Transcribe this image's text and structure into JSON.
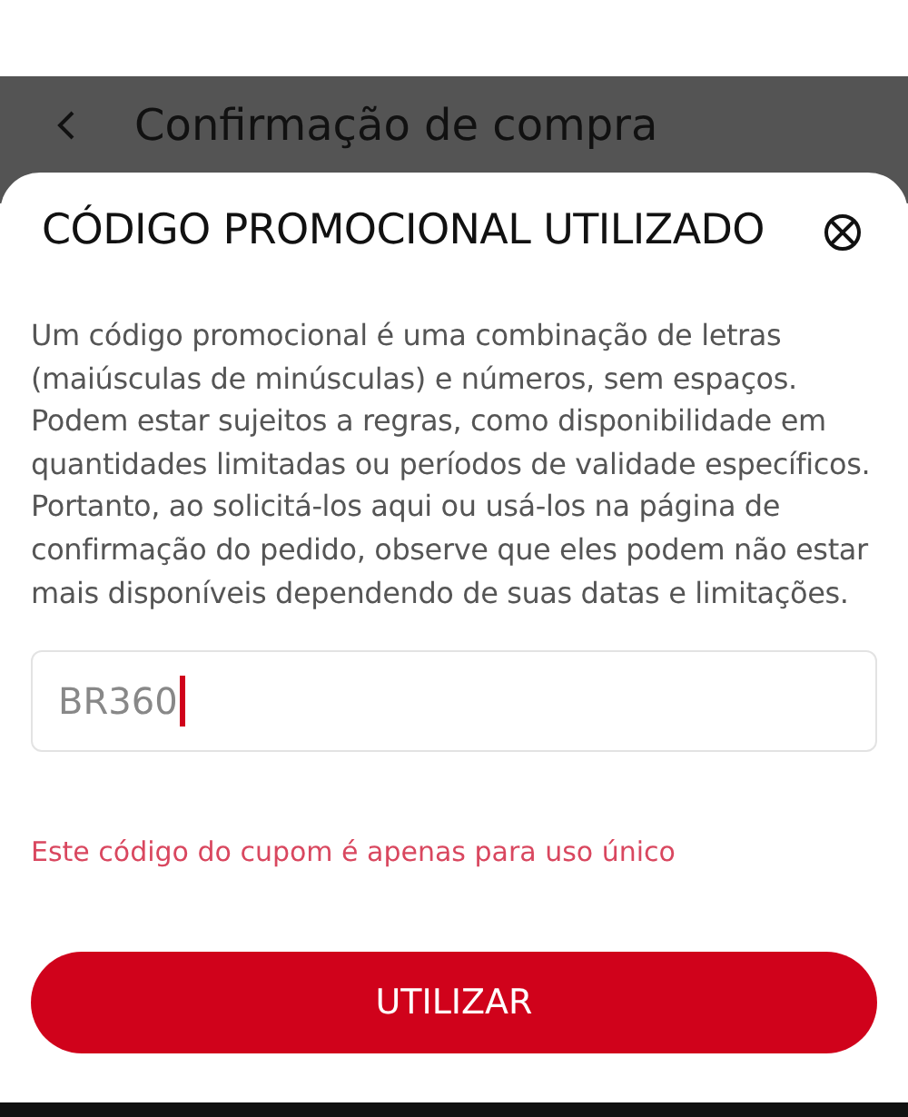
{
  "header": {
    "title": "Confirmação de compra"
  },
  "sheet": {
    "title": "CÓDIGO PROMOCIONAL UTILIZADO",
    "description": "Um código promocional é uma combinação de letras (maiúsculas de minúsculas) e números, sem espaços. Podem estar sujeitos a regras, como disponibilidade em quantidades limitadas ou períodos de validade específicos. Portanto, ao solicitá-los aqui ou usá-los na página de confirmação do pedido, observe que eles podem não estar mais disponíveis dependendo de suas datas e limitações.",
    "code_field": {
      "value": "BR360",
      "focused": true
    },
    "error": "Este código do cupom é apenas para uso único",
    "button": "UTILIZAR"
  }
}
